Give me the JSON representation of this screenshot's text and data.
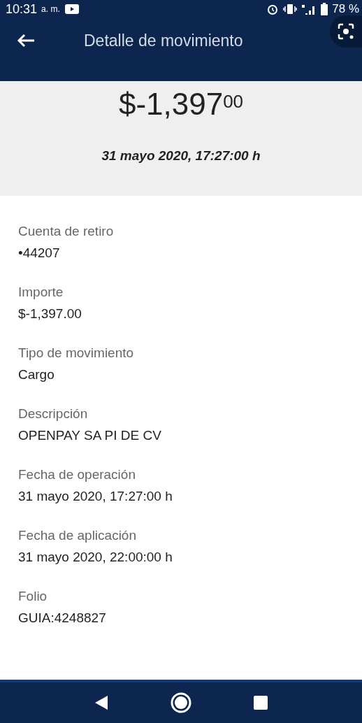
{
  "status_bar": {
    "time": "10:31",
    "meridiem": "a. m.",
    "battery": "78 %"
  },
  "header": {
    "title": "Detalle de movimiento"
  },
  "summary": {
    "amount": "$-1,397$^{00}$",
    "date": "31 mayo 2020, 17:27:00 h"
  },
  "fields": [
    {
      "label": "Cuenta de retiro",
      "value": "•44207"
    },
    {
      "label": "Importe",
      "value": "$-1,397.00"
    },
    {
      "label": "Tipo de movimiento",
      "value": "Cargo"
    },
    {
      "label": "Descripción",
      "value": "OPENPAY SA PI DE CV"
    },
    {
      "label": "Fecha de operación",
      "value": "31 mayo 2020, 17:27:00 h"
    },
    {
      "label": "Fecha de aplicación",
      "value": "31 mayo 2020, 22:00:00 h"
    },
    {
      "label": "Folio",
      "value": "GUIA:4248827"
    }
  ]
}
